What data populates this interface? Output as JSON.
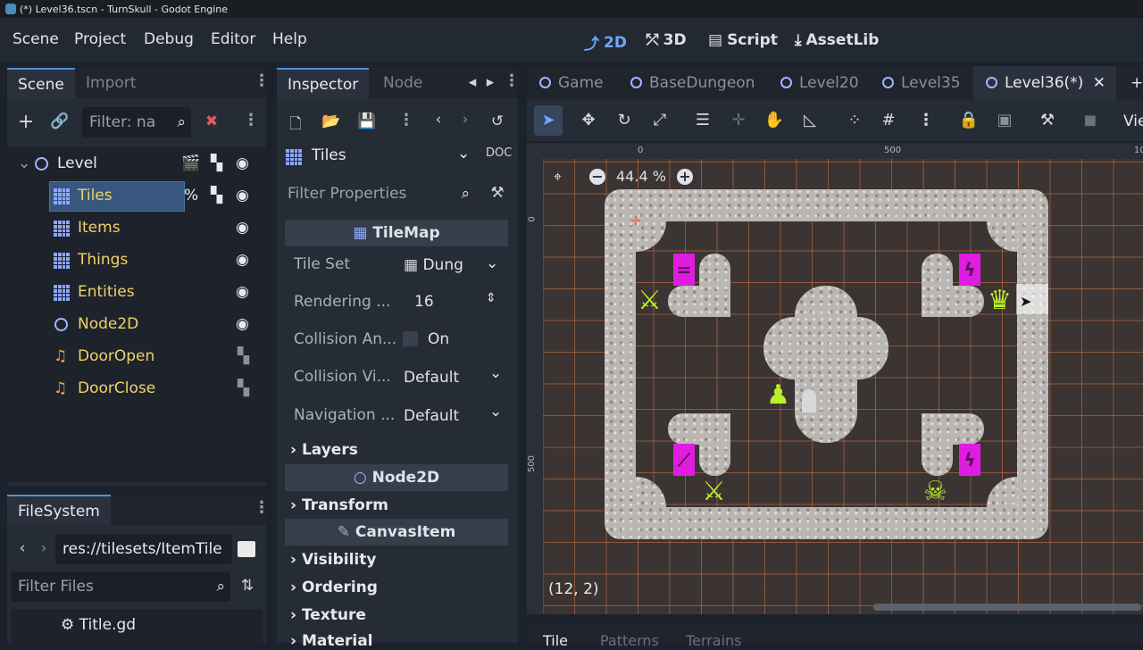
{
  "window_title": "(*) Level36.tscn - TurnSkull - Godot Engine",
  "menu": [
    "Scene",
    "Project",
    "Debug",
    "Editor",
    "Help"
  ],
  "modes": [
    {
      "label": "2D",
      "active": true
    },
    {
      "label": "3D"
    },
    {
      "label": "Script"
    },
    {
      "label": "AssetLib"
    }
  ],
  "scene_panel": {
    "tabs": [
      "Scene",
      "Import"
    ],
    "filter_placeholder": "Filter: na",
    "root": "Level",
    "nodes": [
      {
        "label": "Tiles",
        "icon": "tilemap-icon",
        "selected": true
      },
      {
        "label": "Items",
        "icon": "tilemap-icon"
      },
      {
        "label": "Things",
        "icon": "tilemap-icon"
      },
      {
        "label": "Entities",
        "icon": "tilemap-icon"
      },
      {
        "label": "Node2D",
        "icon": "node2d-icon"
      },
      {
        "label": "DoorOpen",
        "icon": "audio-icon"
      },
      {
        "label": "DoorClose",
        "icon": "audio-icon"
      }
    ]
  },
  "filesystem": {
    "tab": "FileSystem",
    "path": "res://tilesets/ItemTile",
    "filter_placeholder": "Filter Files",
    "items": [
      "Title.gd"
    ]
  },
  "inspector": {
    "tabs": [
      "Inspector",
      "Node"
    ],
    "object": "Tiles",
    "filter_placeholder": "Filter Properties",
    "class_tilemap": "TileMap",
    "props": [
      {
        "name": "Tile Set",
        "value": "Dung"
      },
      {
        "name": "Rendering ...",
        "value": "16"
      },
      {
        "name": "Collision An...",
        "value": "On"
      },
      {
        "name": "Collision Vi...",
        "value": "Default"
      },
      {
        "name": "Navigation ...",
        "value": "Default"
      }
    ],
    "groups": [
      "Layers",
      "Transform",
      "Visibility",
      "Ordering",
      "Texture",
      "Material"
    ],
    "class_node2d": "Node2D",
    "class_canvasitem": "CanvasItem"
  },
  "viewport": {
    "tabs": [
      {
        "label": "Game"
      },
      {
        "label": "BaseDungeon"
      },
      {
        "label": "Level20"
      },
      {
        "label": "Level35"
      },
      {
        "label": "Level36(*)",
        "active": true
      }
    ],
    "view_label": "Vie",
    "zoom": "44.4 %",
    "cursor_coords": "(12, 2)",
    "ruler_ticks": [
      "0",
      "500",
      "10"
    ],
    "ruler_left_ticks": [
      "0",
      "500"
    ]
  },
  "bottom": {
    "tabs": [
      "Tile",
      "Patterns",
      "Terrains"
    ]
  }
}
